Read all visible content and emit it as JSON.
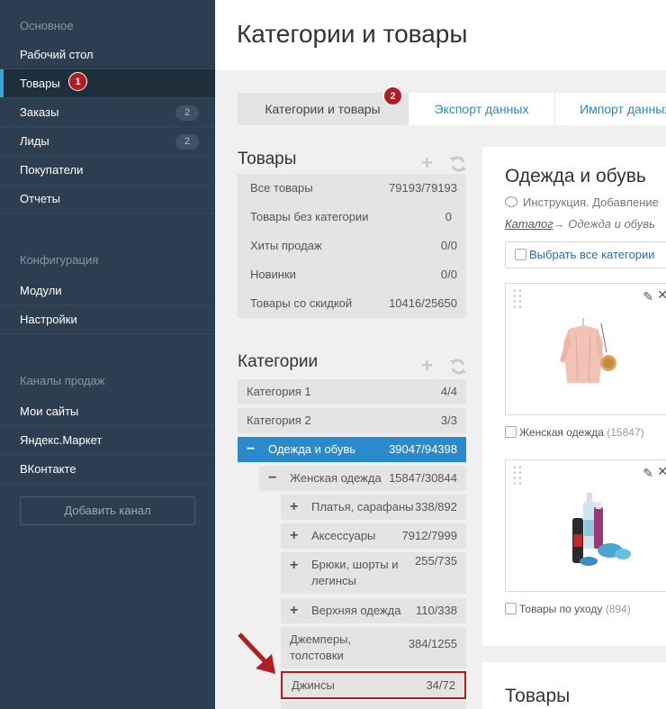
{
  "sidebar": {
    "section_main": "Основное",
    "main_items": [
      {
        "label": "Рабочий стол",
        "count": ""
      },
      {
        "label": "Товары",
        "count": ""
      },
      {
        "label": "Заказы",
        "count": "2"
      },
      {
        "label": "Лиды",
        "count": "2"
      },
      {
        "label": "Покупатели",
        "count": ""
      },
      {
        "label": "Отчеты",
        "count": ""
      }
    ],
    "section_config": "Конфигурация",
    "config_items": [
      {
        "label": "Модули"
      },
      {
        "label": "Настройки"
      }
    ],
    "section_channels": "Каналы продаж",
    "channel_items": [
      {
        "label": "Мои сайты"
      },
      {
        "label": "Яндекс.Маркет"
      },
      {
        "label": "ВКонтакте"
      }
    ],
    "add_channel": "Добавить канал"
  },
  "badges": {
    "one": "1",
    "two": "2"
  },
  "header": {
    "title": "Категории и товары"
  },
  "tabs": [
    {
      "label": "Категории и товары"
    },
    {
      "label": "Экспорт данных"
    },
    {
      "label": "Импорт данных"
    }
  ],
  "products_panel": {
    "title": "Товары",
    "rows": [
      {
        "label": "Все товары",
        "value": "79193/79193"
      },
      {
        "label": "Товары без категории",
        "value": "0"
      },
      {
        "label": "Хиты продаж",
        "value": "0/0"
      },
      {
        "label": "Новинки",
        "value": "0/0"
      },
      {
        "label": "Товары со скидкой",
        "value": "10416/25650"
      }
    ]
  },
  "categories_panel": {
    "title": "Категории",
    "rows": [
      {
        "label": "Категория 1",
        "value": "4/4",
        "sym": ""
      },
      {
        "label": "Категория 2",
        "value": "3/3",
        "sym": ""
      },
      {
        "label": "Одежда и обувь",
        "value": "39047/94398",
        "sym": "−"
      },
      {
        "label": "Женская одежда",
        "value": "15847/30844",
        "sym": "−"
      },
      {
        "label": "Платья, сарафаны",
        "value": "338/892",
        "sym": "+"
      },
      {
        "label": "Аксессуары",
        "value": "7912/7999",
        "sym": "+"
      },
      {
        "label": "Брюки, шорты и легинсы",
        "value": "255/735",
        "sym": "+"
      },
      {
        "label": "Верхняя одежда",
        "value": "110/338",
        "sym": "+"
      },
      {
        "label": "Джемперы, толстовки",
        "value": "384/1255",
        "sym": ""
      },
      {
        "label": "Джинсы",
        "value": "34/72",
        "sym": ""
      }
    ]
  },
  "category_detail": {
    "title": "Одежда и обувь",
    "instruction": "Инструкция. Добавление",
    "breadcrumb_link": "Каталог",
    "breadcrumb_rest": "→ Одежда и обувь",
    "select_all": "Выбрать все категории",
    "subcategories": [
      {
        "label": "Женская одежда",
        "count": "(15847)"
      },
      {
        "label": "Товары по уходу",
        "count": "(894)"
      }
    ]
  },
  "products_section": {
    "title": "Товары"
  },
  "icons": {
    "plus": "plus-icon",
    "refresh": "refresh-icon",
    "edit": "pencil-icon",
    "close": "close-icon",
    "drag": "drag-handle-icon",
    "comment": "comment-icon"
  },
  "colors": {
    "sidebar_bg": "#2d3e50",
    "accent": "#2a8acb",
    "badge_red": "#b01e23"
  }
}
